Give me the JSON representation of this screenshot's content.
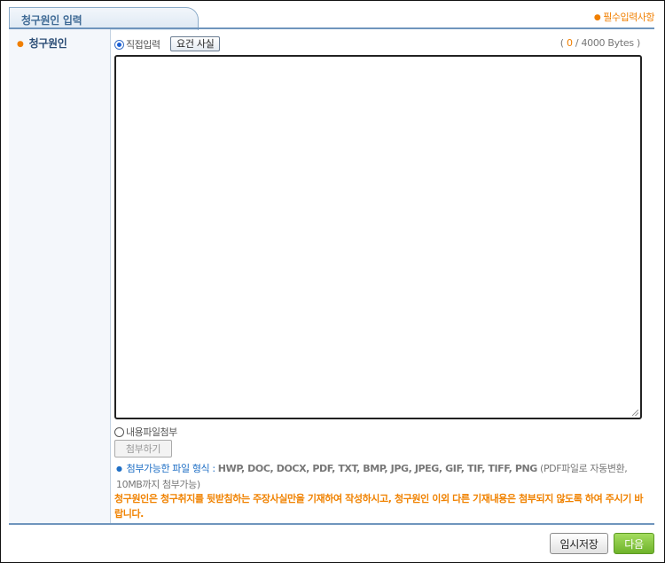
{
  "header": {
    "tab_title": "청구원인 입력",
    "required_note": "필수입력사항"
  },
  "form": {
    "field_label": "청구원인",
    "option_direct": "직접입력",
    "summary_button": "요건 사실",
    "bytes_prefix": "(",
    "bytes_current": "0",
    "bytes_suffix": "/ 4000 Bytes )",
    "text_value": "",
    "option_file": "내용파일첨부",
    "attach_button": "첨부하기",
    "file_formats_label": "첨부가능한 파일 형식 :",
    "file_formats": "HWP, DOC, DOCX, PDF, TXT, BMP, JPG, JPEG, GIF, TIF, TIFF, PNG",
    "file_formats_note": "(PDF파일로 자동변환, 10MB까지 첨부가능)",
    "warning": "청구원인은 청구취지를 뒷받침하는 주장사실만을 기재하여 작성하시고, 청구원인 이외 다른 기재내용은 첨부되지 않도록 하여 주시기 바랍니다."
  },
  "footer": {
    "save_button": "임시저장",
    "next_button": "다음"
  },
  "colors": {
    "accent_orange": "#f07f00",
    "header_blue": "#3f6a95",
    "link_blue": "#1f6fc5",
    "next_green": "#6fb32b"
  }
}
